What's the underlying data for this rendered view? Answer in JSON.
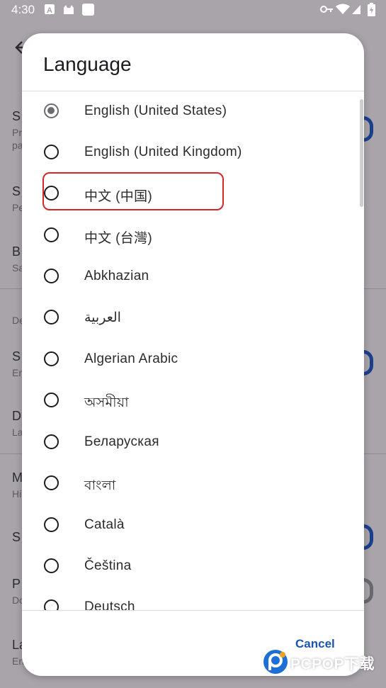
{
  "status_bar": {
    "time": "4:30",
    "icons": [
      "app-a-icon",
      "android-icon",
      "app-square-icon",
      "vpn-key-icon",
      "wifi-icon",
      "signal-icon",
      "battery-charging-icon"
    ]
  },
  "background": {
    "back_icon": "arrow-back-icon",
    "items": [
      {
        "title": "S",
        "subtitle": "Pr"
      },
      {
        "title": "",
        "subtitle": "pa"
      },
      {
        "title": "S",
        "subtitle": "Pe"
      },
      {
        "title": "B",
        "subtitle": "Sa"
      },
      {
        "title": "",
        "subtitle": "De"
      },
      {
        "title": "S",
        "subtitle": "En"
      },
      {
        "title": "D",
        "subtitle": "La"
      },
      {
        "title": "M",
        "subtitle": "Hi"
      },
      {
        "title": "S",
        "subtitle": ""
      },
      {
        "title": "P",
        "subtitle": "Do"
      },
      {
        "title": "La",
        "subtitle": "En"
      }
    ]
  },
  "dialog": {
    "title": "Language",
    "selected": "English (United States)",
    "options": [
      {
        "label": "English (United States)",
        "checked": true
      },
      {
        "label": "English (United Kingdom)",
        "checked": false
      },
      {
        "label": "中文 (中国)",
        "checked": false
      },
      {
        "label": "中文 (台灣)",
        "checked": false
      },
      {
        "label": "Abkhazian",
        "checked": false
      },
      {
        "label": "العربية",
        "checked": false
      },
      {
        "label": "Algerian Arabic",
        "checked": false
      },
      {
        "label": "অসমীয়া",
        "checked": false
      },
      {
        "label": "Беларуская",
        "checked": false
      },
      {
        "label": "বাংলা",
        "checked": false
      },
      {
        "label": "Català",
        "checked": false
      },
      {
        "label": "Čeština",
        "checked": false
      },
      {
        "label": "Deutsch",
        "checked": false
      }
    ],
    "cancel_label": "Cancel"
  },
  "watermark": {
    "brand": "PCPOP下载",
    "sub": "PCPOP Download"
  },
  "colors": {
    "accent": "#1a56b0",
    "highlight": "#d7262a",
    "scrim": "#a8a4aa"
  }
}
